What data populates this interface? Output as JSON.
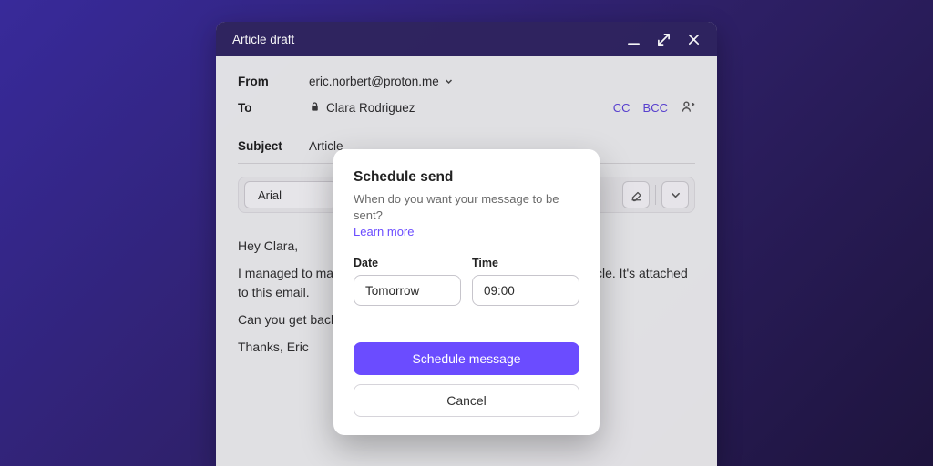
{
  "titlebar": {
    "title": "Article draft"
  },
  "from": {
    "label": "From",
    "value": "eric.norbert@proton.me"
  },
  "to": {
    "label": "To",
    "recipient": "Clara Rodriguez",
    "cc": "CC",
    "bcc": "BCC"
  },
  "subject": {
    "label": "Subject",
    "prefix": "Article"
  },
  "toolbar": {
    "font": "Arial"
  },
  "body": {
    "greeting": "Hey Clara,",
    "p1": "I managed to make some good progress on the draft for the article. It's attached to this email.",
    "p2": "Can you get back to me …",
    "signoff": "Thanks, Eric"
  },
  "modal": {
    "title": "Schedule send",
    "subtitle": "When do you want your message to be sent?",
    "learn": "Learn more",
    "date_label": "Date",
    "date_value": "Tomorrow",
    "time_label": "Time",
    "time_value": "09:00",
    "primary": "Schedule message",
    "secondary": "Cancel"
  },
  "colors": {
    "accent": "#6b4cff"
  }
}
